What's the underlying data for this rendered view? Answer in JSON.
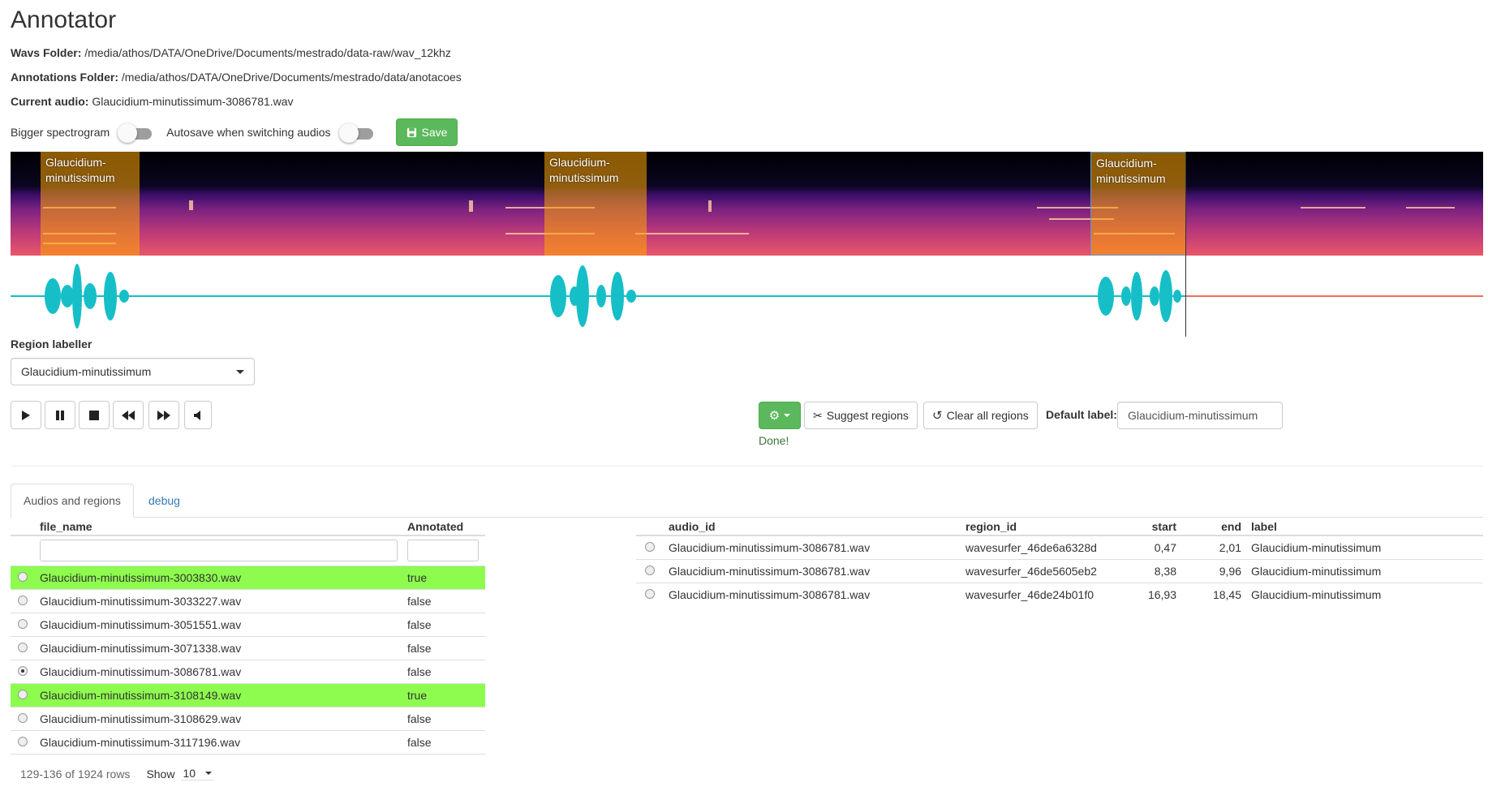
{
  "app": {
    "title": "Annotator"
  },
  "info": {
    "wavs_folder_label": "Wavs Folder:",
    "wavs_folder_value": "/media/athos/DATA/OneDrive/Documents/mestrado/data-raw/wav_12khz",
    "annotations_folder_label": "Annotations Folder:",
    "annotations_folder_value": "/media/athos/DATA/OneDrive/Documents/mestrado/data/anotacoes",
    "current_audio_label": "Current audio:",
    "current_audio_value": "Glaucidium-minutissimum-3086781.wav"
  },
  "controls": {
    "bigger_spectrogram_label": "Bigger spectrogram",
    "autosave_label": "Autosave when switching audios",
    "save_label": "Save"
  },
  "regions": [
    {
      "label_line1": "Glaucidium-",
      "label_line2": "minutissimum"
    },
    {
      "label_line1": "Glaucidium-",
      "label_line2": "minutissimum"
    },
    {
      "label_line1": "Glaucidium-",
      "label_line2": "minutissimum"
    }
  ],
  "labeller": {
    "section_label": "Region labeller",
    "selected": "Glaucidium-minutissimum"
  },
  "actions": {
    "suggest_label": "Suggest regions",
    "clear_label": "Clear all regions",
    "default_label_label": "Default label:",
    "default_label_value": "Glaucidium-minutissimum",
    "status": "Done!"
  },
  "tabs": [
    {
      "label": "Audios and regions"
    },
    {
      "label": "debug"
    }
  ],
  "files_table": {
    "headers": [
      "file_name",
      "Annotated"
    ],
    "rows": [
      {
        "file_name": "Glaucidium-minutissimum-3003830.wav",
        "annotated": "true"
      },
      {
        "file_name": "Glaucidium-minutissimum-3033227.wav",
        "annotated": "false"
      },
      {
        "file_name": "Glaucidium-minutissimum-3051551.wav",
        "annotated": "false"
      },
      {
        "file_name": "Glaucidium-minutissimum-3071338.wav",
        "annotated": "false"
      },
      {
        "file_name": "Glaucidium-minutissimum-3086781.wav",
        "annotated": "false"
      },
      {
        "file_name": "Glaucidium-minutissimum-3108149.wav",
        "annotated": "true"
      },
      {
        "file_name": "Glaucidium-minutissimum-3108629.wav",
        "annotated": "false"
      },
      {
        "file_name": "Glaucidium-minutissimum-3117196.wav",
        "annotated": "false"
      }
    ],
    "rows_info": "129-136 of 1924 rows",
    "show_label": "Show",
    "page_size": "10"
  },
  "regions_table": {
    "headers": [
      "audio_id",
      "region_id",
      "start",
      "end",
      "label"
    ],
    "rows": [
      {
        "audio_id": "Glaucidium-minutissimum-3086781.wav",
        "region_id": "wavesurfer_46de6a6328d",
        "start": "0,47",
        "end": "2,01",
        "label": "Glaucidium-minutissimum"
      },
      {
        "audio_id": "Glaucidium-minutissimum-3086781.wav",
        "region_id": "wavesurfer_46de5605eb2",
        "start": "8,38",
        "end": "9,96",
        "label": "Glaucidium-minutissimum"
      },
      {
        "audio_id": "Glaucidium-minutissimum-3086781.wav",
        "region_id": "wavesurfer_46de24b01f0",
        "start": "16,93",
        "end": "18,45",
        "label": "Glaucidium-minutissimum"
      }
    ]
  },
  "colors": {
    "accent_green": "#5cb85c",
    "annotated_row": "#8efc4e",
    "wave_played": "#16bfc7",
    "wave_unplayed": "#f46b5e",
    "region_fill": "#ffa500"
  }
}
